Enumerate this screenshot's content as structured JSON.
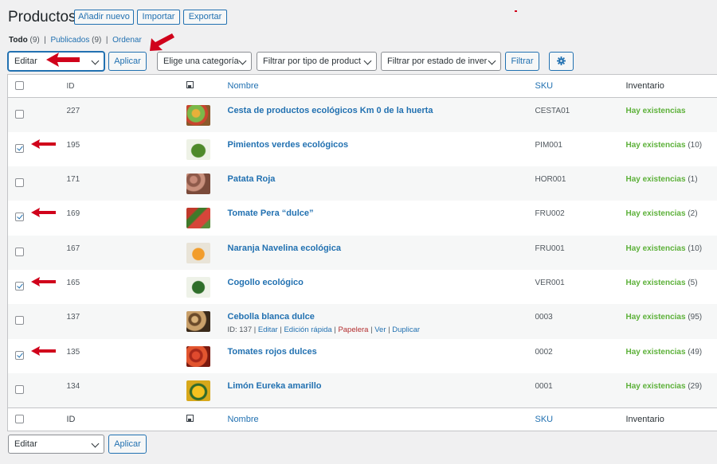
{
  "page": {
    "title": "Productos",
    "buttons": {
      "add_new": "Añadir nuevo",
      "import": "Importar",
      "export": "Exportar"
    }
  },
  "subsubsub": {
    "all_label": "Todo",
    "all_count": "(9)",
    "published_label": "Publicados",
    "published_count": "(9)",
    "sort_label": "Ordenar"
  },
  "filters": {
    "bulk_action_top": "Editar",
    "apply_top": "Aplicar",
    "category": "Elige una categoría",
    "product_type": "Filtrar por tipo de product",
    "stock_status": "Filtrar por estado de inver",
    "filter_button": "Filtrar",
    "bulk_action_bottom": "Editar",
    "apply_bottom": "Aplicar"
  },
  "table": {
    "columns": {
      "id": "ID",
      "image": "image-icon",
      "name": "Nombre",
      "sku": "SKU",
      "stock": "Inventario"
    },
    "rows": [
      {
        "id": "227",
        "name": "Cesta de productos ecológicos Km 0 de la huerta",
        "sku": "CESTA01",
        "stock": "Hay existencias",
        "qty": "",
        "checked": false,
        "thumb": "basket"
      },
      {
        "id": "195",
        "name": "Pimientos verdes ecológicos",
        "sku": "PIM001",
        "stock": "Hay existencias",
        "qty": "(10)",
        "checked": true,
        "thumb": "pepper"
      },
      {
        "id": "171",
        "name": "Patata Roja",
        "sku": "HOR001",
        "stock": "Hay existencias",
        "qty": "(1)",
        "checked": false,
        "thumb": "potato"
      },
      {
        "id": "169",
        "name": "Tomate Pera “dulce”",
        "sku": "FRU002",
        "stock": "Hay existencias",
        "qty": "(2)",
        "checked": true,
        "thumb": "tomato-pear"
      },
      {
        "id": "167",
        "name": "Naranja Navelina ecológica",
        "sku": "FRU001",
        "stock": "Hay existencias",
        "qty": "(10)",
        "checked": false,
        "thumb": "orange"
      },
      {
        "id": "165",
        "name": "Cogollo ecológico",
        "sku": "VER001",
        "stock": "Hay existencias",
        "qty": "(5)",
        "checked": true,
        "thumb": "lettuce"
      },
      {
        "id": "137",
        "name": "Cebolla blanca dulce",
        "sku": "0003",
        "stock": "Hay existencias",
        "qty": "(95)",
        "checked": false,
        "thumb": "onion",
        "row_actions": {
          "id_label": "ID: 137",
          "edit": "Editar",
          "quick_edit": "Edición rápida",
          "trash": "Papelera",
          "view": "Ver",
          "duplicate": "Duplicar"
        }
      },
      {
        "id": "135",
        "name": "Tomates rojos dulces",
        "sku": "0002",
        "stock": "Hay existencias",
        "qty": "(49)",
        "checked": true,
        "thumb": "tomato"
      },
      {
        "id": "134",
        "name": "Limón Eureka amarillo",
        "sku": "0001",
        "stock": "Hay existencias",
        "qty": "(29)",
        "checked": false,
        "thumb": "lemon"
      }
    ]
  },
  "colors": {
    "accent": "#2271b1",
    "in_stock": "#5db13a",
    "annotation_arrow": "#d0021b",
    "trash": "#b32d2e"
  }
}
